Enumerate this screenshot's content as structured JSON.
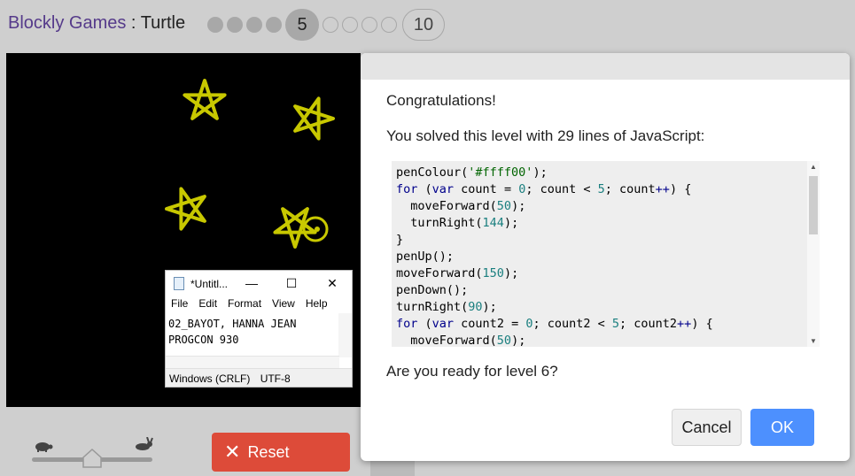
{
  "header": {
    "app_name": "Blockly Games",
    "separator": " : ",
    "game_name": "Turtle",
    "current_level": "5",
    "last_level": "10"
  },
  "notepad": {
    "title": "*Untitl...",
    "min_glyph": "—",
    "max_glyph": "☐",
    "close_glyph": "✕",
    "menu": [
      "File",
      "Edit",
      "Format",
      "View",
      "Help"
    ],
    "lines": [
      "02_BAYOT, HANNA JEAN",
      "PROGCON 930"
    ],
    "status_eol": "Windows (CRLF)",
    "status_enc": "UTF-8"
  },
  "controls": {
    "reset_label": "Reset",
    "reset_icon_glyph": "✕",
    "speed_fraction": 0.5
  },
  "dialog": {
    "heading": "Congratulations!",
    "summary": "You solved this level with 29 lines of JavaScript:",
    "question": "Are you ready for level 6?",
    "cancel_label": "Cancel",
    "ok_label": "OK",
    "code_lines": [
      "penColour('#ffff00');",
      "for (var count = 0; count < 5; count++) {",
      "  moveForward(50);",
      "  turnRight(144);",
      "}",
      "penUp();",
      "moveForward(150);",
      "penDown();",
      "turnRight(90);",
      "for (var count2 = 0; count2 < 5; count2++) {",
      "  moveForward(50);"
    ]
  },
  "colors": {
    "pen": "#ffff00",
    "ok": "#4d90fe",
    "reset": "#dd4b39"
  }
}
